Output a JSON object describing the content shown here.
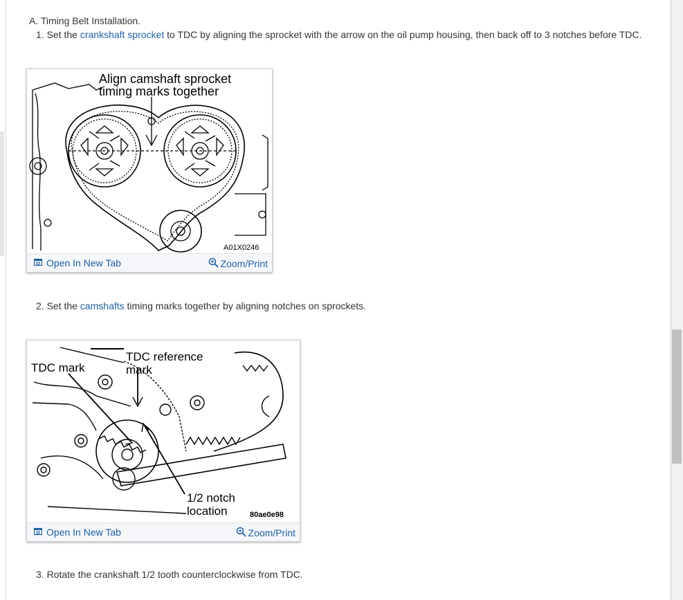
{
  "section": {
    "title": "A. Timing Belt Installation."
  },
  "steps": [
    {
      "prefix": "1. Set the ",
      "link": "crankshaft sprocket",
      "suffix": " to TDC by aligning the sprocket with the arrow on the oil pump housing, then back off to 3 notches before TDC."
    },
    {
      "prefix": "2. Set the ",
      "link": "camshafts",
      "suffix": " timing marks together by aligning notches on sprockets."
    },
    {
      "text": "3. Rotate the crankshaft 1/2 tooth counterclockwise from TDC."
    }
  ],
  "figures": [
    {
      "caption_line1": "Align  camshaft  sprocket",
      "caption_line2": "timing marks together",
      "code": "A01X0246",
      "open_label": "Open In New Tab",
      "zoom_label": "Zoom/Print",
      "icons": [
        "open-tab-icon",
        "zoom-icon"
      ]
    },
    {
      "label_tdc_mark": "TDC mark",
      "label_ref_line1": "TDC reference",
      "label_ref_line2": "mark",
      "label_notch_line1": "1/2 notch",
      "label_notch_line2": "location",
      "code": "80ae0e98",
      "open_label": "Open In New Tab",
      "zoom_label": "Zoom/Print",
      "icons": [
        "open-tab-icon",
        "zoom-icon"
      ]
    }
  ]
}
